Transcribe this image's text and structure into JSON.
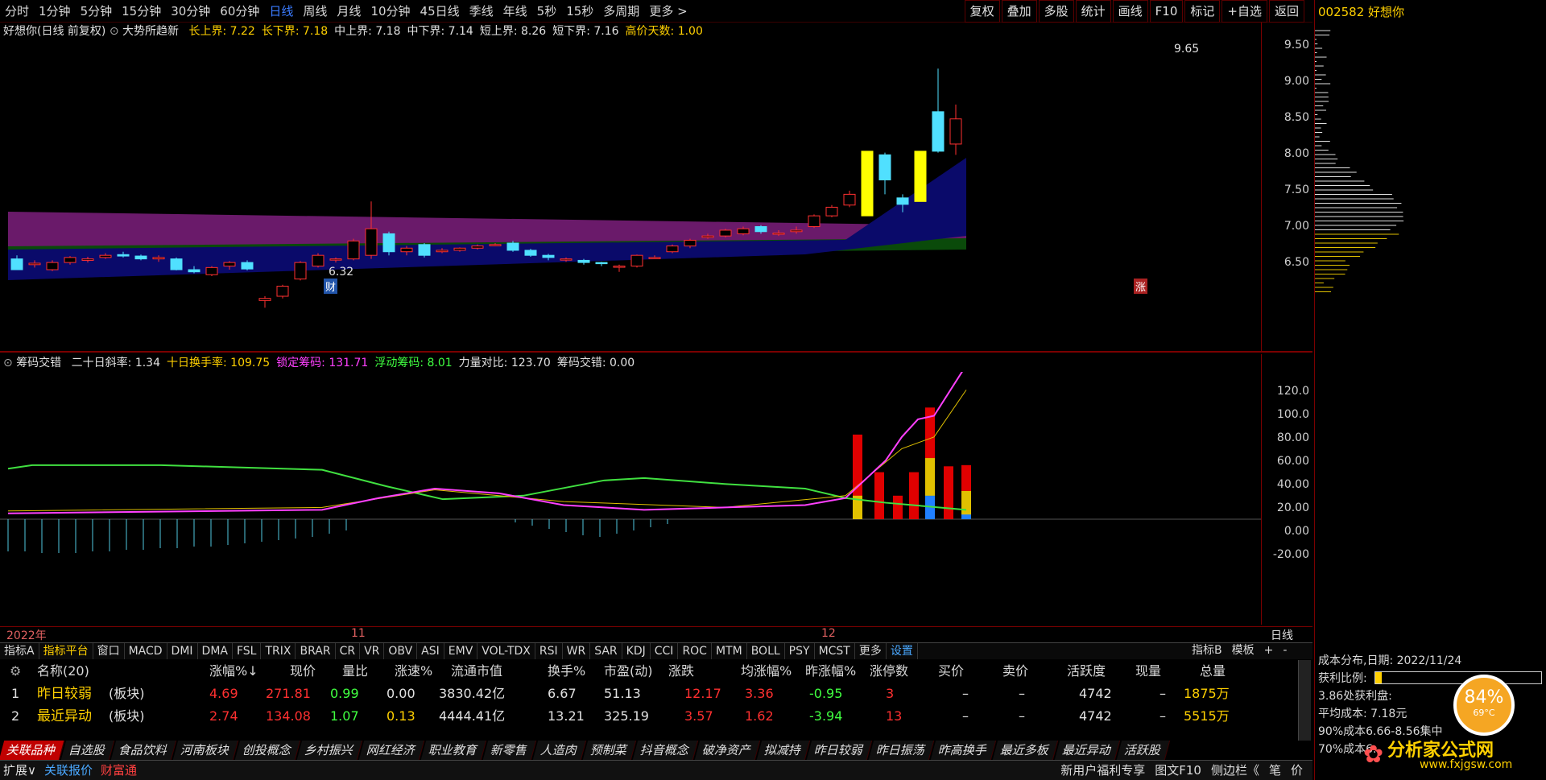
{
  "periods": [
    "分时",
    "1分钟",
    "5分钟",
    "15分钟",
    "30分钟",
    "60分钟",
    "日线",
    "周线",
    "月线",
    "10分钟",
    "45日线",
    "季线",
    "年线",
    "5秒",
    "15秒",
    "多周期",
    "更多 >"
  ],
  "active_period": "日线",
  "toolbar": [
    "复权",
    "叠加",
    "多股",
    "统计",
    "画线",
    "F10",
    "标记",
    "+自选",
    "返回"
  ],
  "stock": {
    "code_name": "002582 好想你"
  },
  "main": {
    "title": "好想你(日线 前复权)",
    "indicator": "大势所趋新",
    "labels": [
      {
        "name": "长上界",
        "value": "7.22",
        "color": "#ffd000"
      },
      {
        "name": "长下界",
        "value": "7.18",
        "color": "#ffd000"
      },
      {
        "name": "中上界",
        "value": "7.18",
        "color": "#e0e0e0"
      },
      {
        "name": "中下界",
        "value": "7.14",
        "color": "#e0e0e0"
      },
      {
        "name": "短上界",
        "value": "8.26",
        "color": "#e0e0e0"
      },
      {
        "name": "短下界",
        "value": "7.16",
        "color": "#e0e0e0"
      },
      {
        "name": "高价天数",
        "value": "1.00",
        "color": "#ffd000"
      }
    ],
    "price_axis": [
      "9.50",
      "9.00",
      "8.50",
      "8.00",
      "7.50",
      "7.00",
      "6.50"
    ],
    "high_mark": "9.65",
    "low_mark": "6.32",
    "cai": "财",
    "zhang": "涨"
  },
  "sub": {
    "title": "筹码交错",
    "labels": [
      {
        "name": "二十日斜率",
        "value": "1.34",
        "color": "#e0e0e0"
      },
      {
        "name": "十日换手率",
        "value": "109.75",
        "color": "#ffd000"
      },
      {
        "name": "锁定筹码",
        "value": "131.71",
        "color": "#ff40ff"
      },
      {
        "name": "浮动筹码",
        "value": "8.01",
        "color": "#40ff40"
      },
      {
        "name": "力量对比",
        "value": "123.70",
        "color": "#e0e0e0"
      },
      {
        "name": "筹码交错",
        "value": "0.00",
        "color": "#e0e0e0"
      }
    ],
    "axis": [
      "120.0",
      "100.0",
      "80.00",
      "60.00",
      "40.00",
      "20.00",
      "0.00",
      "-20.00"
    ]
  },
  "dates": {
    "year": "2022年",
    "m11": "11",
    "m12": "12",
    "mode": "日线"
  },
  "tabs": [
    "指标A",
    "指标平台",
    "窗口",
    "MACD",
    "DMI",
    "DMA",
    "FSL",
    "TRIX",
    "BRAR",
    "CR",
    "VR",
    "OBV",
    "ASI",
    "EMV",
    "VOL-TDX",
    "RSI",
    "WR",
    "SAR",
    "KDJ",
    "CCI",
    "ROC",
    "MTM",
    "BOLL",
    "PSY",
    "MCST",
    "更多",
    "设置"
  ],
  "tabs_right": [
    "指标B",
    "模板",
    "+",
    "-"
  ],
  "table": {
    "headers": [
      "名称(20)",
      "涨幅%↓",
      "现价",
      "量比",
      "涨速%",
      "流通市值",
      "换手%",
      "市盈(动)",
      "涨跌",
      "均涨幅%",
      "昨涨幅%",
      "涨停数",
      "买价",
      "卖价",
      "活跃度",
      "现量",
      "总量"
    ],
    "rows": [
      [
        "1",
        "昨日较弱",
        "(板块)",
        "4.69",
        "271.81",
        "0.99",
        "0.00",
        "3830.42亿",
        "6.67",
        "51.13",
        "12.17",
        "3.36",
        "-0.95",
        "3",
        "–",
        "–",
        "4742",
        "–",
        "1875万"
      ],
      [
        "2",
        "最近异动",
        "(板块)",
        "2.74",
        "134.08",
        "1.07",
        "0.13",
        "4444.41亿",
        "13.21",
        "325.19",
        "3.57",
        "1.62",
        "-3.94",
        "13",
        "–",
        "–",
        "4742",
        "–",
        "5515万"
      ]
    ]
  },
  "sectors": [
    "关联品种",
    "自选股",
    "食品饮料",
    "河南板块",
    "创投概念",
    "乡村振兴",
    "网红经济",
    "职业教育",
    "新零售",
    "人造肉",
    "预制菜",
    "抖音概念",
    "破净资产",
    "拟减持",
    "昨日较弱",
    "昨日振荡",
    "昨高换手",
    "最近多板",
    "最近异动",
    "活跃股"
  ],
  "status": {
    "left": [
      "扩展∨",
      "关联报价",
      "财富通"
    ],
    "right": [
      "新用户福利专享",
      "图文F10",
      "侧边栏《",
      "笔",
      "价"
    ]
  },
  "side": {
    "title": "成本分布,日期: 2022/11/24",
    "profit_label": "获利比例:",
    "profit_line": "3.86处获利盘:",
    "avg": "平均成本: 7.18元",
    "c90": "90%成本6.66-8.56集中",
    "c70": "70%成本6.",
    "gauge": "84%",
    "temp": "69°C",
    "logo": "分析家公式网",
    "url": "www.fxjgsw.com"
  },
  "colors": {
    "up": "#ff3030",
    "down": "#50e0ff",
    "axis": "#7a0000"
  }
}
